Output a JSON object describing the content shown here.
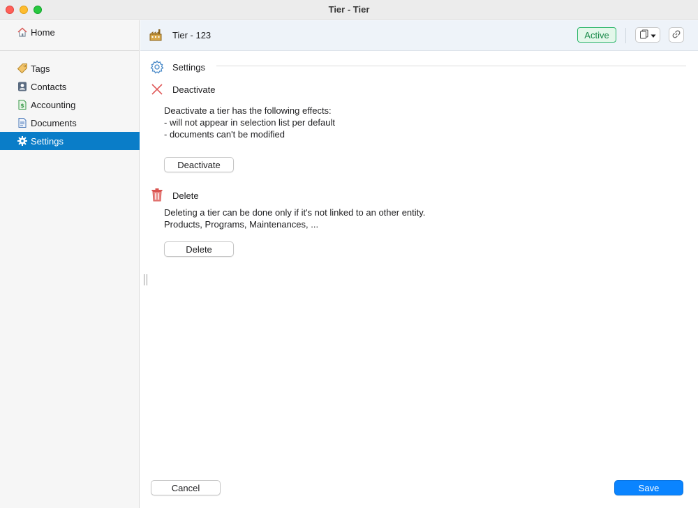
{
  "window": {
    "title": "Tier - Tier"
  },
  "sidebar": {
    "home": {
      "label": "Home",
      "icon": "home-icon"
    },
    "items": [
      {
        "label": "Tags",
        "icon": "tag-icon",
        "active": false
      },
      {
        "label": "Contacts",
        "icon": "contact-card-icon",
        "active": false
      },
      {
        "label": "Accounting",
        "icon": "ledger-icon",
        "active": false
      },
      {
        "label": "Documents",
        "icon": "document-icon",
        "active": false
      },
      {
        "label": "Settings",
        "icon": "gear-icon",
        "active": true
      }
    ]
  },
  "header": {
    "title": "Tier - 123",
    "status": "Active",
    "icon": "factory-icon"
  },
  "settings": {
    "title": "Settings",
    "deactivate": {
      "title": "Deactivate",
      "description_lines": [
        "Deactivate a tier has the following effects:",
        "- will not appear in selection list per default",
        "- documents can't be modified"
      ],
      "button": "Deactivate"
    },
    "delete": {
      "title": "Delete",
      "description_lines": [
        "Deleting a tier can be done only if it's not linked to an other entity.",
        "Products, Programs, Maintenances, ..."
      ],
      "button": "Delete"
    }
  },
  "footer": {
    "cancel": "Cancel",
    "save": "Save"
  },
  "colors": {
    "accent": "#0a7dc8",
    "primary_button": "#0a84ff",
    "status_green": "#2db66a",
    "delete_red": "#d9534f"
  }
}
